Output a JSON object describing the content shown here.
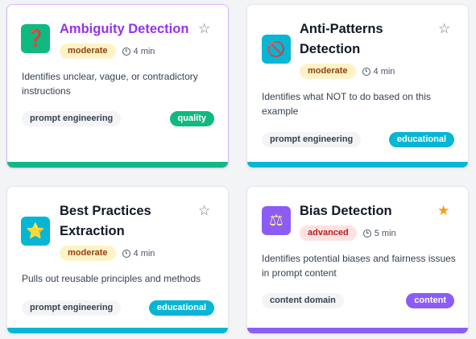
{
  "cards": [
    {
      "title": "Ambiguity Detection",
      "icon": "question-mark-icon",
      "icon_glyph": "❓",
      "icon_color": "#10b981",
      "level": "moderate",
      "time": "4 min",
      "favorited": false,
      "star_glyph": "☆",
      "description": "Identifies unclear, vague, or contradictory instructions",
      "tag": "prompt engineering",
      "category": "quality",
      "category_color": "#10b981"
    },
    {
      "title_line1": "Anti-Patterns",
      "title_line2": "Detection",
      "icon": "prohibited-icon",
      "icon_glyph": "🚫",
      "icon_color": "#06b6d4",
      "level": "moderate",
      "time": "4 min",
      "favorited": false,
      "star_glyph": "☆",
      "description": "Identifies what NOT to do based on this example",
      "tag": "prompt engineering",
      "category": "educational",
      "category_color": "#06b6d4"
    },
    {
      "title_line1": "Best Practices",
      "title_line2": "Extraction",
      "icon": "star-icon",
      "icon_glyph": "⭐",
      "icon_color": "#06b6d4",
      "level": "moderate",
      "time": "4 min",
      "favorited": false,
      "star_glyph": "☆",
      "description": "Pulls out reusable principles and methods",
      "tag": "prompt engineering",
      "category": "educational",
      "category_color": "#06b6d4"
    },
    {
      "title": "Bias Detection",
      "icon": "balance-scale-icon",
      "icon_glyph": "⚖",
      "icon_color": "#8b5cf6",
      "level": "advanced",
      "time": "5 min",
      "favorited": true,
      "star_glyph": "★",
      "description": "Identifies potential biases and fairness issues in prompt content",
      "tag": "content domain",
      "category": "content",
      "category_color": "#8b5cf6"
    }
  ]
}
